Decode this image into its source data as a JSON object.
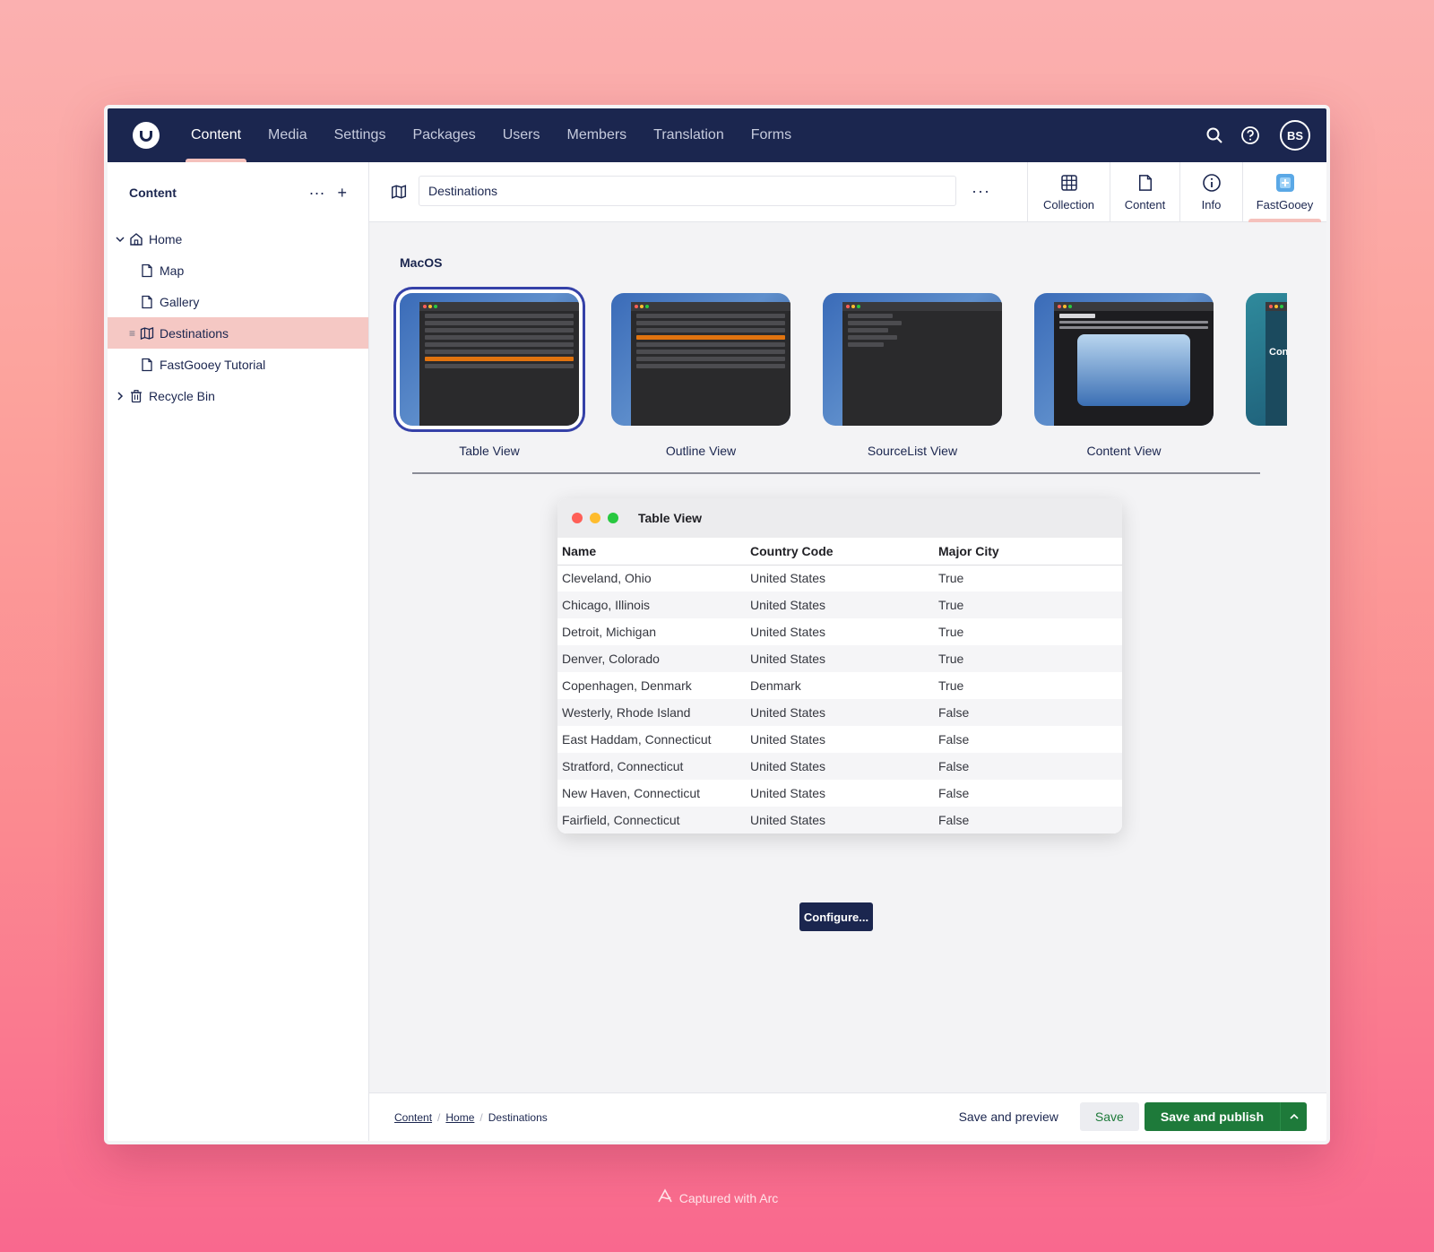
{
  "nav": {
    "items": [
      "Content",
      "Media",
      "Settings",
      "Packages",
      "Users",
      "Members",
      "Translation",
      "Forms"
    ],
    "active": "Content",
    "avatar": "BS"
  },
  "sidebar": {
    "title": "Content",
    "tree": [
      {
        "label": "Home",
        "icon": "home-icon"
      },
      {
        "label": "Map",
        "icon": "document-icon"
      },
      {
        "label": "Gallery",
        "icon": "document-icon"
      },
      {
        "label": "Destinations",
        "icon": "map-icon"
      },
      {
        "label": "FastGooey Tutorial",
        "icon": "document-icon"
      },
      {
        "label": "Recycle Bin",
        "icon": "trash-icon"
      }
    ]
  },
  "editor": {
    "name_value": "Destinations",
    "views": [
      {
        "label": "Collection",
        "icon": "grid-icon"
      },
      {
        "label": "Content",
        "icon": "document-icon"
      },
      {
        "label": "Info",
        "icon": "info-icon"
      },
      {
        "label": "FastGooey",
        "icon": "fastgooey-icon"
      }
    ],
    "section_title": "MacOS",
    "thumbnails": [
      "Table View",
      "Outline View",
      "SourceList View",
      "Content View"
    ],
    "thumbnail_overlay_text": "Conta"
  },
  "preview": {
    "title": "Table View",
    "columns": [
      "Name",
      "Country Code",
      "Major City"
    ],
    "rows": [
      [
        "Cleveland, Ohio",
        "United States",
        "True"
      ],
      [
        "Chicago, Illinois",
        "United States",
        "True"
      ],
      [
        "Detroit, Michigan",
        "United States",
        "True"
      ],
      [
        "Denver, Colorado",
        "United States",
        "True"
      ],
      [
        "Copenhagen, Denmark",
        "Denmark",
        "True"
      ],
      [
        "Westerly, Rhode Island",
        "United States",
        "False"
      ],
      [
        "East Haddam, Connecticut",
        "United States",
        "False"
      ],
      [
        "Stratford, Connecticut",
        "United States",
        "False"
      ],
      [
        "New Haven, Connecticut",
        "United States",
        "False"
      ],
      [
        "Fairfield, Connecticut",
        "United States",
        "False"
      ]
    ],
    "configure_label": "Configure..."
  },
  "footer": {
    "breadcrumb": [
      "Content",
      "Home",
      "Destinations"
    ],
    "save_preview": "Save and preview",
    "save": "Save",
    "save_publish": "Save and publish"
  },
  "watermark": "Captured with Arc",
  "colors": {
    "nav_bg": "#1b264f",
    "accent": "#f5c1bc",
    "publish_green": "#1e7a3a",
    "selection_ring": "#3541a8"
  }
}
